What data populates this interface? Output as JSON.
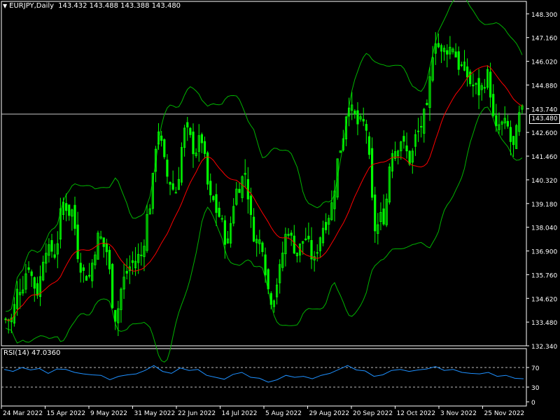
{
  "header": {
    "symbol": "EURJPY,Daily",
    "ohlc": "143.432 143.488 143.388 143.480"
  },
  "current_price": "143.480",
  "rsi": {
    "label": "RSI(14) 47.0360",
    "levels": [
      "70",
      "30",
      "0"
    ]
  },
  "colors": {
    "background": "#000000",
    "candles": "#00ff00",
    "moving_average": "#ff0000",
    "bollinger": "#00b400",
    "rsi_line": "#1e90ff",
    "grid_text": "#ffffff"
  },
  "chart_data": [
    {
      "type": "line",
      "title": "EURJPY,Daily",
      "series": [
        {
          "name": "EURJPY,Daily",
          "values": [
            133.6,
            135.2,
            136.3,
            135.0,
            137.2,
            136.8,
            139.2,
            138.8,
            136.3,
            135.7,
            137.5,
            136.9,
            133.8,
            135.5,
            136.3,
            136.7,
            139.2,
            142.8,
            140.5,
            139.8,
            142.6,
            141.9,
            142.3,
            139.3,
            138.6,
            137.2,
            139.8,
            140.7,
            137.8,
            137.3,
            134.7,
            135.9,
            138.0,
            136.9,
            137.5,
            136.3,
            138.1,
            139.1,
            141.9,
            144.2,
            143.0,
            142.8,
            138.0,
            138.6,
            141.9,
            142.3,
            141.3,
            142.6,
            143.5,
            147.2,
            146.5,
            146.8,
            145.7,
            145.0,
            144.6,
            145.3,
            142.6,
            142.9,
            141.8,
            143.48
          ]
        }
      ],
      "ytick_labels": [
        "148.300",
        "147.160",
        "146.020",
        "144.880",
        "143.740",
        "142.600",
        "141.460",
        "140.320",
        "139.180",
        "138.040",
        "136.900",
        "135.760",
        "134.620",
        "133.480",
        "132.340"
      ],
      "xtick_labels": [
        "24 Mar 2022",
        "15 Apr 2022",
        "9 May 2022",
        "31 May 2022",
        "22 Jun 2022",
        "14 Jul 2022",
        "5 Aug 2022",
        "29 Aug 2022",
        "20 Sep 2022",
        "12 Oct 2022",
        "3 Nov 2022",
        "25 Nov 2022"
      ],
      "ylim": [
        132.34,
        148.9
      ]
    },
    {
      "type": "line",
      "title": "RSI(14) 47.0360",
      "series": [
        {
          "name": "RSI(14)",
          "values": [
            66,
            62,
            70,
            65,
            68,
            58,
            67,
            66,
            60,
            57,
            55,
            54,
            45,
            52,
            55,
            57,
            64,
            74,
            62,
            58,
            69,
            64,
            66,
            54,
            50,
            46,
            56,
            60,
            50,
            48,
            40,
            45,
            54,
            50,
            52,
            47,
            54,
            58,
            66,
            74,
            65,
            63,
            52,
            55,
            64,
            66,
            62,
            65,
            67,
            72,
            64,
            66,
            60,
            58,
            57,
            60,
            52,
            54,
            48,
            47
          ]
        }
      ],
      "ytick_labels": [
        "70",
        "30",
        "0"
      ],
      "ylim": [
        0,
        100
      ]
    }
  ]
}
